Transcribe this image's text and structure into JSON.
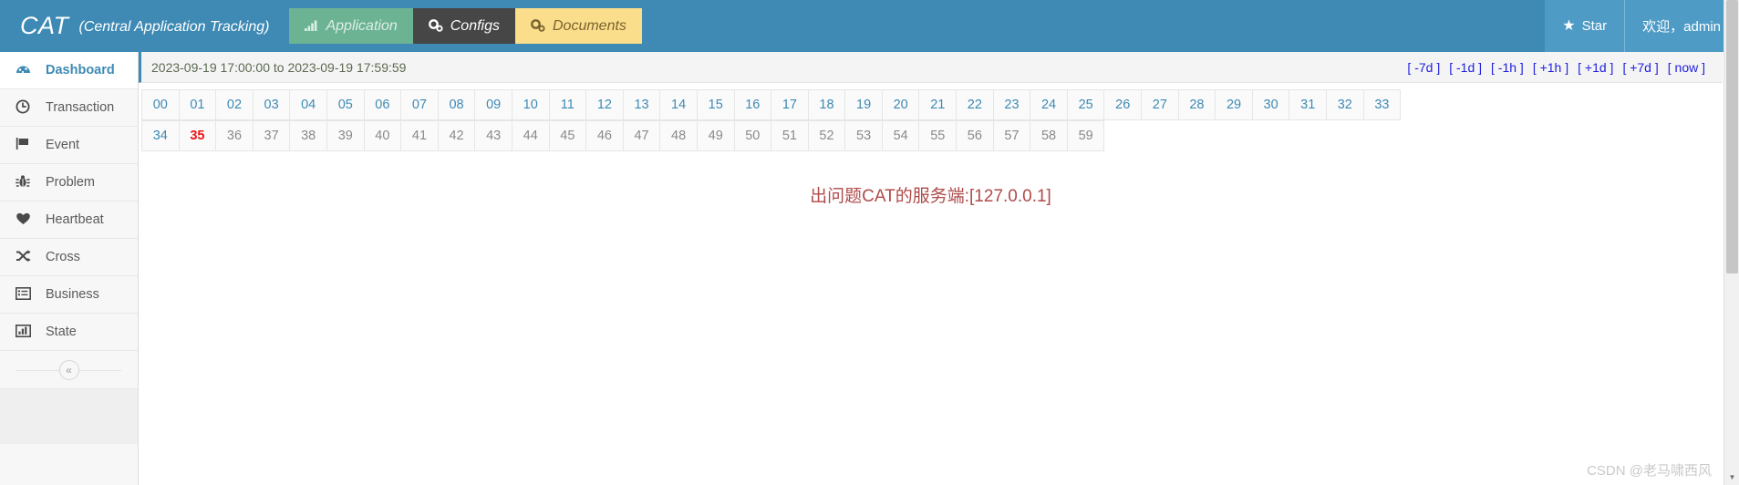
{
  "header": {
    "brand_short": "CAT",
    "brand_full": "(Central Application Tracking)",
    "tabs": [
      {
        "label": "Application",
        "icon": "bar-chart-icon",
        "glyph": "▁▃▅",
        "state": "application"
      },
      {
        "label": "Configs",
        "icon": "gears-icon",
        "glyph": "⚙",
        "state": "configs"
      },
      {
        "label": "Documents",
        "icon": "gears-icon",
        "glyph": "⚙",
        "state": "documents"
      }
    ],
    "star_label": "Star",
    "star_glyph": "★",
    "welcome_text": "欢迎，admin"
  },
  "sidebar": {
    "items": [
      {
        "label": "Dashboard",
        "icon": "dashboard-icon",
        "glyph": "◕",
        "active": true
      },
      {
        "label": "Transaction",
        "icon": "clock-icon",
        "glyph": "◷",
        "active": false
      },
      {
        "label": "Event",
        "icon": "flag-icon",
        "glyph": "⚑",
        "active": false
      },
      {
        "label": "Problem",
        "icon": "bug-icon",
        "glyph": "✲",
        "active": false
      },
      {
        "label": "Heartbeat",
        "icon": "heart-icon",
        "glyph": "♥",
        "active": false
      },
      {
        "label": "Cross",
        "icon": "shuffle-icon",
        "glyph": "⤫",
        "active": false
      },
      {
        "label": "Business",
        "icon": "list-alt-icon",
        "glyph": "▤",
        "active": false
      },
      {
        "label": "State",
        "icon": "bar-chart-icon",
        "glyph": "▥",
        "active": false
      }
    ],
    "collapse_glyph": "«",
    "collapse_name": "collapse-sidebar-button"
  },
  "main": {
    "date_range": "2023-09-19 17:00:00 to 2023-09-19 17:59:59",
    "range_links": [
      "[ -7d ]",
      "[ -1d ]",
      "[ -1h ]",
      "[ +1h ]",
      "[ +1d ]",
      "[ +7d ]",
      "[ now ]"
    ],
    "minutes_row1": [
      "00",
      "01",
      "02",
      "03",
      "04",
      "05",
      "06",
      "07",
      "08",
      "09",
      "10",
      "11",
      "12",
      "13",
      "14",
      "15",
      "16",
      "17",
      "18",
      "19",
      "20",
      "21",
      "22",
      "23",
      "24",
      "25",
      "26",
      "27",
      "28",
      "29",
      "30",
      "31",
      "32",
      "33"
    ],
    "minutes_row2": [
      "34",
      "35",
      "36",
      "37",
      "38",
      "39",
      "40",
      "41",
      "42",
      "43",
      "44",
      "45",
      "46",
      "47",
      "48",
      "49",
      "50",
      "51",
      "52",
      "53",
      "54",
      "55",
      "56",
      "57",
      "58",
      "59"
    ],
    "current_minute": "35",
    "error_message": "出问题CAT的服务端:[127.0.0.1]"
  },
  "watermark": "CSDN @老马啸西风",
  "colors": {
    "header_blue": "#3e8ab4",
    "header_blue_light": "#4e9bc6",
    "tab_green": "#6cb394",
    "tab_dark": "#464646",
    "tab_yellow": "#fade8b",
    "link_blue": "#3e8ab4",
    "range_link_blue": "#2020e0",
    "current_red": "#ef1414",
    "error_red": "#b04a4a",
    "future_gray": "#8a8a8a",
    "sidebar_bg": "#f7f7f7"
  }
}
